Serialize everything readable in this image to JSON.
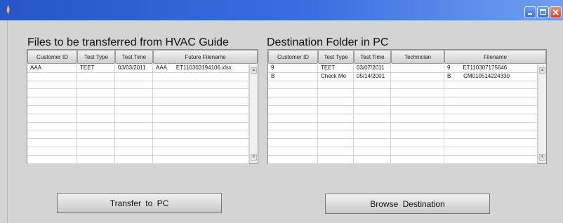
{
  "window": {
    "title": ""
  },
  "left_panel": {
    "title": "Files to be transferred from HVAC Guide",
    "columns": [
      "Customer ID",
      "Test Type",
      "Test Time",
      "Future Filename"
    ],
    "rows": [
      [
        "AAA",
        "TEET",
        "03/03/2011",
        "AAA      ET110303194106.xlsx"
      ]
    ]
  },
  "right_panel": {
    "title": "Destination Folder in PC",
    "columns": [
      "Customer ID",
      "Test Type",
      "Test Time",
      "Technician",
      "Filename"
    ],
    "rows": [
      [
        "9",
        "TEET",
        "03/07/2011",
        "",
        "9        ET110307175646"
      ],
      [
        "B",
        "Check Me",
        "05/14/2001",
        "",
        "B        CM010514224330"
      ]
    ]
  },
  "buttons": {
    "transfer": "Transfer to PC",
    "browse": "Browse Destination"
  },
  "icons": {
    "app": "flame-icon",
    "minimize": "minimize-icon",
    "maximize": "maximize-icon",
    "close": "close-icon",
    "scroll_up": "scroll-up-arrow-icon",
    "scroll_down": "scroll-down-arrow-icon"
  },
  "colors": {
    "titlebar": "#2656c8",
    "close_button": "#d8431c",
    "background": "#d4d4d4"
  }
}
